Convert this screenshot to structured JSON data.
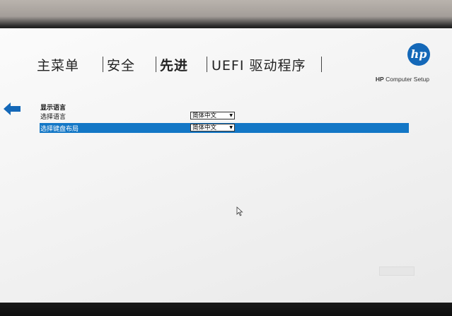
{
  "menu": {
    "items": [
      {
        "label": "主菜单"
      },
      {
        "label": "安全"
      },
      {
        "label": "先进"
      },
      {
        "label": "UEFI 驱动程序"
      }
    ]
  },
  "header": {
    "brand_strong": "HP",
    "brand_rest": " Computer Setup",
    "logo_text": "hp"
  },
  "content": {
    "section_title": "显示语言",
    "rows": [
      {
        "label": "选择语言",
        "value": "简体中文"
      },
      {
        "label": "选择键盘布局",
        "value": "简体中文"
      }
    ]
  },
  "colors": {
    "accent": "#1377c6",
    "logo": "#1468b8"
  },
  "icons": {
    "back": "left-arrow-icon",
    "pointer": "mouse-pointer-icon",
    "dropdown": "dropdown-arrow-icon"
  }
}
